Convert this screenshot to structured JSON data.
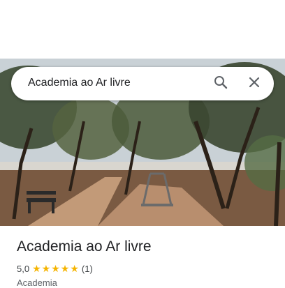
{
  "search": {
    "query": "Academia ao Ar livre"
  },
  "place": {
    "title": "Academia ao Ar livre",
    "rating": "5,0",
    "review_count": "(1)",
    "category": "Academia",
    "stars": [
      "★",
      "★",
      "★",
      "★",
      "★"
    ],
    "star_color": "#f5b400"
  },
  "icons": {
    "search": "search-icon",
    "close": "close-icon"
  }
}
